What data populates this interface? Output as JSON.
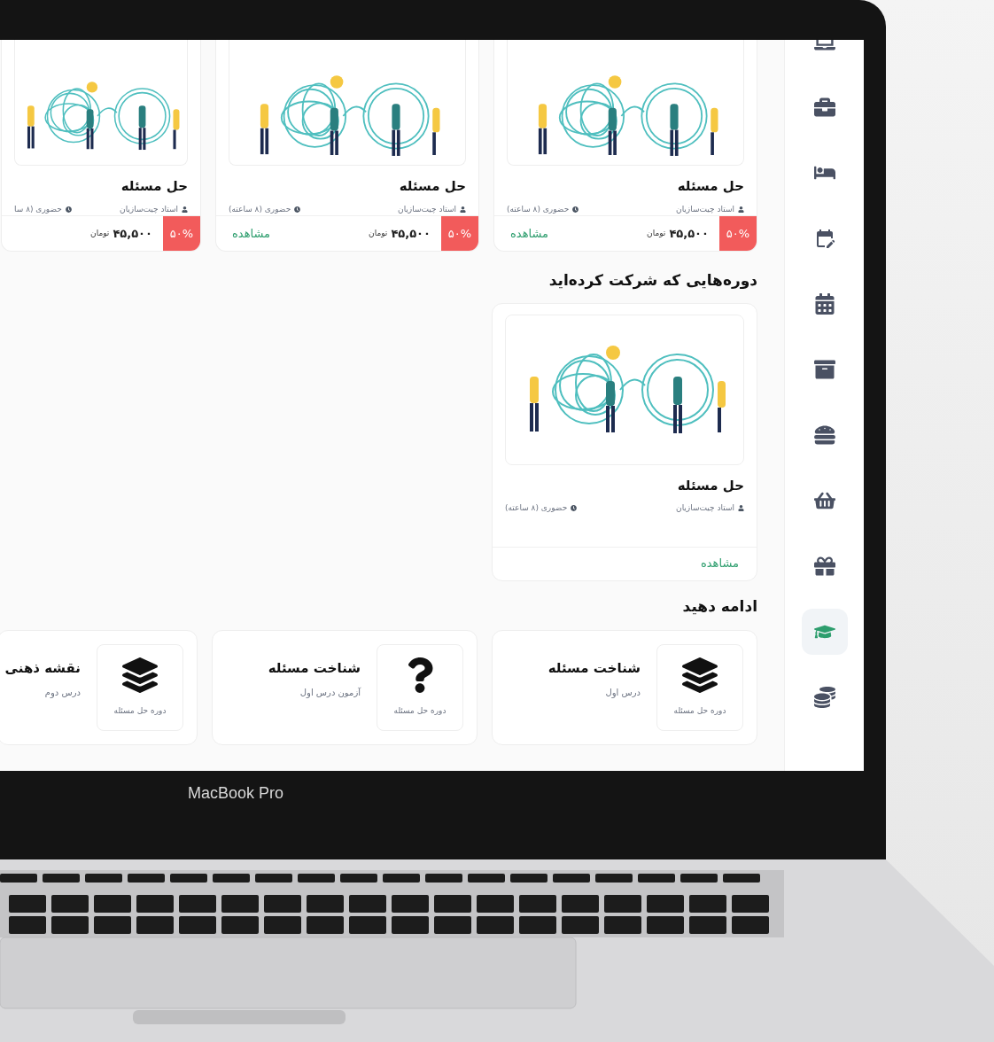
{
  "popular_courses": [
    {
      "title": "حل مسئله",
      "teacher": "استاد چیت‌سازیان",
      "mode": "حضوری (۸ ساعته)",
      "discount": "۵۰%",
      "price": "۴۵,۵۰۰",
      "currency": "تومان",
      "link": "مشاهده"
    },
    {
      "title": "حل مسئله",
      "teacher": "استاد چیت‌سازیان",
      "mode": "حضوری (۸ ساعته)",
      "discount": "۵۰%",
      "price": "۴۵,۵۰۰",
      "currency": "تومان",
      "link": "مشاهده"
    },
    {
      "title": "حل مسئله",
      "teacher": "استاد چیت‌سازیان",
      "mode": "حضوری (۸ سا",
      "discount": "۵۰%",
      "price": "۴۵,۵۰۰",
      "currency": "تومان"
    }
  ],
  "enrolled": {
    "heading": "دوره‌هایی که شرکت کرده‌اید",
    "courses": [
      {
        "title": "حل مسئله",
        "teacher": "استاد چیت‌سازیان",
        "mode": "حضوری (۸ ساعته)",
        "link": "مشاهده"
      }
    ]
  },
  "continue": {
    "heading": "ادامه دهید",
    "items": [
      {
        "kind": "lesson",
        "course": "دوره حل مسئله",
        "title": "شناخت مسئله",
        "subtitle": "درس اول"
      },
      {
        "kind": "quiz",
        "course": "دوره حل مسئله",
        "title": "شناخت مسئله",
        "subtitle": "آزمون درس اول"
      },
      {
        "kind": "lesson",
        "course": "دوره حل مسئله",
        "title": "نقشه ذهنی",
        "subtitle": "درس دوم"
      }
    ]
  },
  "sidebar": {
    "items": [
      {
        "selected": false
      },
      {
        "selected": false
      },
      {
        "selected": false
      },
      {
        "selected": false
      },
      {
        "selected": false
      },
      {
        "selected": false
      },
      {
        "selected": false
      },
      {
        "selected": false
      },
      {
        "selected": false
      },
      {
        "selected": true
      },
      {
        "selected": false
      }
    ]
  },
  "laptop": {
    "label": "MacBook Pro"
  }
}
